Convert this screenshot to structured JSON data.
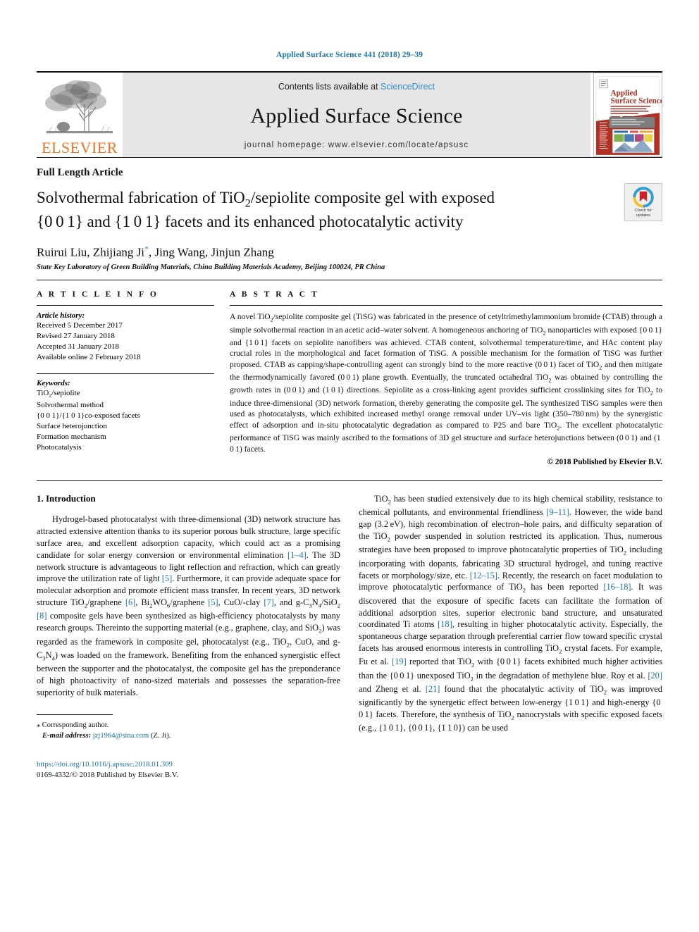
{
  "running_head": "Applied Surface Science 441 (2018) 29–39",
  "masthead": {
    "publisher_name": "ELSEVIER",
    "contents_prefix": "Contents lists available at ",
    "contents_link": "ScienceDirect",
    "journal_title": "Applied Surface Science",
    "homepage_line": "journal homepage: www.elsevier.com/locate/apsusc",
    "cover_title_line1": "Applied",
    "cover_title_line2": "Surface Science",
    "link_color": "#2e8ed0",
    "accent_orange": "#E87722"
  },
  "title_block": {
    "article_type": "Full Length Article",
    "title_line1": "Solvothermal fabrication of TiO2/sepiolite composite gel with exposed",
    "title_line2": "{0 0 1} and {1 0 1} facets and its enhanced photocatalytic activity",
    "authors": "Ruirui Liu, Zhijiang Ji",
    "authors_tail": ", Jing Wang, Jinjun Zhang",
    "corresponding_marker": "*",
    "affiliation": "State Key Laboratory of Green Building Materials, China Building Materials Academy, Beijing 100024, PR China",
    "crossmark_label_line1": "Check for",
    "crossmark_label_line2": "updates"
  },
  "article_info": {
    "heading": "A R T I C L E   I N F O",
    "history_label": "Article history:",
    "history": [
      "Received 5 December 2017",
      "Revised 27 January 2018",
      "Accepted 31 January 2018",
      "Available online 2 February 2018"
    ],
    "keywords_label": "Keywords:",
    "keywords": [
      "TiO2/sepiolite",
      "Solvothermal method",
      "{0 0 1}/{1 0 1}co-exposed facets",
      "Surface heterojunction",
      "Formation mechanism",
      "Photocatalysis"
    ]
  },
  "abstract": {
    "heading": "A B S T R A C T",
    "text": "A novel TiO2/sepiolite composite gel (TiSG) was fabricated in the presence of cetyltrimethylammonium bromide (CTAB) through a simple solvothermal reaction in an acetic acid–water solvent. A homogeneous anchoring of TiO2 nanoparticles with exposed {0 0 1} and {1 0 1} facets on sepiolite nanofibers was achieved. CTAB content, solvothermal temperature/time, and HAc content play crucial roles in the morphological and facet formation of TiSG. A possible mechanism for the formation of TiSG was further proposed. CTAB as capping/shape-controlling agent can strongly bind to the more reactive (0 0 1) facet of TiO2 and then mitigate the thermodynamically favored (0 0 1) plane growth. Eventually, the truncated octahedral TiO2 was obtained by controlling the growth rates in (0 0 1) and (1 0 1) directions. Sepiolite as a cross-linking agent provides sufficient crosslinking sites for TiO2 to induce three-dimensional (3D) network formation, thereby generating the composite gel. The synthesized TiSG samples were then used as photocatalysts, which exhibited increased methyl orange removal under UV–vis light (350–780 nm) by the synergistic effect of adsorption and in-situ photocatalytic degradation as compared to P25 and bare TiO2. The excellent photocatalytic performance of TiSG was mainly ascribed to the formations of 3D gel structure and surface heterojunctions between (0 0 1) and (1 0 1) facets.",
    "copyright": "© 2018 Published by Elsevier B.V."
  },
  "body": {
    "section_heading": "1. Introduction",
    "left_paragraphs": [
      "Hydrogel-based photocatalyst with three-dimensional (3D) network structure has attracted extensive attention thanks to its superior porous bulk structure, large specific surface area, and excellent adsorption capacity, which could act as a promising candidate for solar energy conversion or environmental elimination [1–4]. The 3D network structure is advantageous to light reflection and refraction, which can greatly improve the utilization rate of light [5]. Furthermore, it can provide adequate space for molecular adsorption and promote efficient mass transfer. In recent years, 3D network structure TiO2/graphene [6], Bi2WO6/graphene [5], CuO/-clay [7], and g-C3N4/SiO2 [8] composite gels have been synthesized as high-efficiency photocatalysts by many research groups. Thereinto the supporting material (e.g., graphene, clay, and SiO2) was regarded as the framework in composite gel, photocatalyst (e.g., TiO2, CuO, and g-C3N4) was loaded on the framework. Benefiting from the enhanced synergistic effect between the supporter and the photocatalyst, the composite gel has the preponderance of high photoactivity of nano-sized materials and possesses the separation-free superiority of bulk materials."
    ],
    "right_paragraphs": [
      "TiO2 has been studied extensively due to its high chemical stability, resistance to chemical pollutants, and environmental friendliness [9–11]. However, the wide band gap (3.2 eV), high recombination of electron–hole pairs, and difficulty separation of the TiO2 powder suspended in solution restricted its application. Thus, numerous strategies have been proposed to improve photocatalytic properties of TiO2 including incorporating with dopants, fabricating 3D structural hydrogel, and tuning reactive facets or morphology/size, etc. [12–15]. Recently, the research on facet modulation to improve photocatalytic performance of TiO2 has been reported [16–18]. It was discovered that the exposure of specific facets can facilitate the formation of additional adsorption sites, superior electronic band structure, and unsaturated coordinated Ti atoms [18], resulting in higher photocatalytic activity. Especially, the spontaneous charge separation through preferential carrier flow toward specific crystal facets has aroused enormous interests in controlling TiO2 crystal facets. For example, Fu et al. [19] reported that TiO2 with {0 0 1} facets exhibited much higher activities than the {0 0 1} unexposed TiO2 in the degradation of methylene blue. Roy et al. [20] and Zheng et al. [21] found that the phocatalytic activity of TiO2 was improved significantly by the synergetic effect between low-energy {1 0 1} and high-energy {0 0 1} facets. Therefore, the synthesis of TiO2 nanocrystals with specific exposed facets (e.g., {1 0 1}, {0 0 1}, {1 1 0}) can be used"
    ]
  },
  "footnotes": {
    "corresponding_star": "⁎",
    "corresponding_text": "Corresponding author.",
    "email_label": "E-mail address:",
    "email": "jzj1964@sina.com",
    "email_suffix": "(Z. Ji).",
    "doi": "https://doi.org/10.1016/j.apsusc.2018.01.309",
    "issn_line": "0169-4332/© 2018 Published by Elsevier B.V."
  }
}
